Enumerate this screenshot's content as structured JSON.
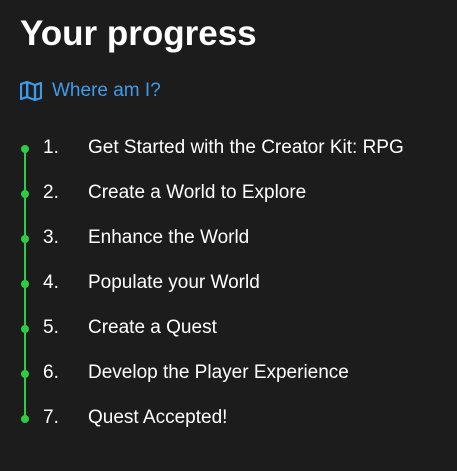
{
  "title": "Your progress",
  "where_link": {
    "icon": "map-icon",
    "label": "Where am I?"
  },
  "colors": {
    "background": "#1c1c1c",
    "accent_link": "#3d9be9",
    "timeline_green": "#2ecc40",
    "text": "#ffffff"
  },
  "steps": [
    {
      "number": "1.",
      "label": "Get Started with the Creator Kit: RPG"
    },
    {
      "number": "2.",
      "label": "Create a World to Explore"
    },
    {
      "number": "3.",
      "label": "Enhance the World"
    },
    {
      "number": "4.",
      "label": "Populate your World"
    },
    {
      "number": "5.",
      "label": "Create a Quest"
    },
    {
      "number": "6.",
      "label": "Develop the Player Experience"
    },
    {
      "number": "7.",
      "label": "Quest Accepted!"
    }
  ]
}
